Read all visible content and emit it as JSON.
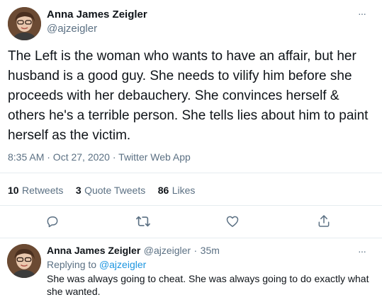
{
  "tweet": {
    "author_name": "Anna James Zeigler",
    "author_handle": "@ajzeigler",
    "text": "The Left is the woman who wants to have an affair, but her husband is a good guy. She needs to vilify him before she proceeds with her debauchery. She convinces herself & others he's a terrible person. She tells lies about him to paint herself as the victim.",
    "timestamp": "8:35 AM · Oct 27, 2020 · Twitter Web App",
    "stats": {
      "retweets_count": "10",
      "retweets_label": "Retweets",
      "quote_count": "3",
      "quote_label": "Quote Tweets",
      "likes_count": "86",
      "likes_label": "Likes"
    },
    "more_glyph": "···"
  },
  "actions": {
    "reply_icon": "reply-icon",
    "retweet_icon": "retweet-icon",
    "like_icon": "heart-icon",
    "share_icon": "share-icon"
  },
  "reply": {
    "author_name": "Anna James Zeigler",
    "author_handle": "@ajzeigler",
    "separator": "·",
    "time": "35m",
    "replying_prefix": "Replying to",
    "replying_handle": "@ajzeigler",
    "text": "She was always going to cheat. She was always going to do exactly what she wanted.",
    "more_glyph": "···"
  },
  "colors": {
    "secondary_text": "#5b7083",
    "link": "#1b95e0",
    "divider": "#e6ecf0"
  }
}
